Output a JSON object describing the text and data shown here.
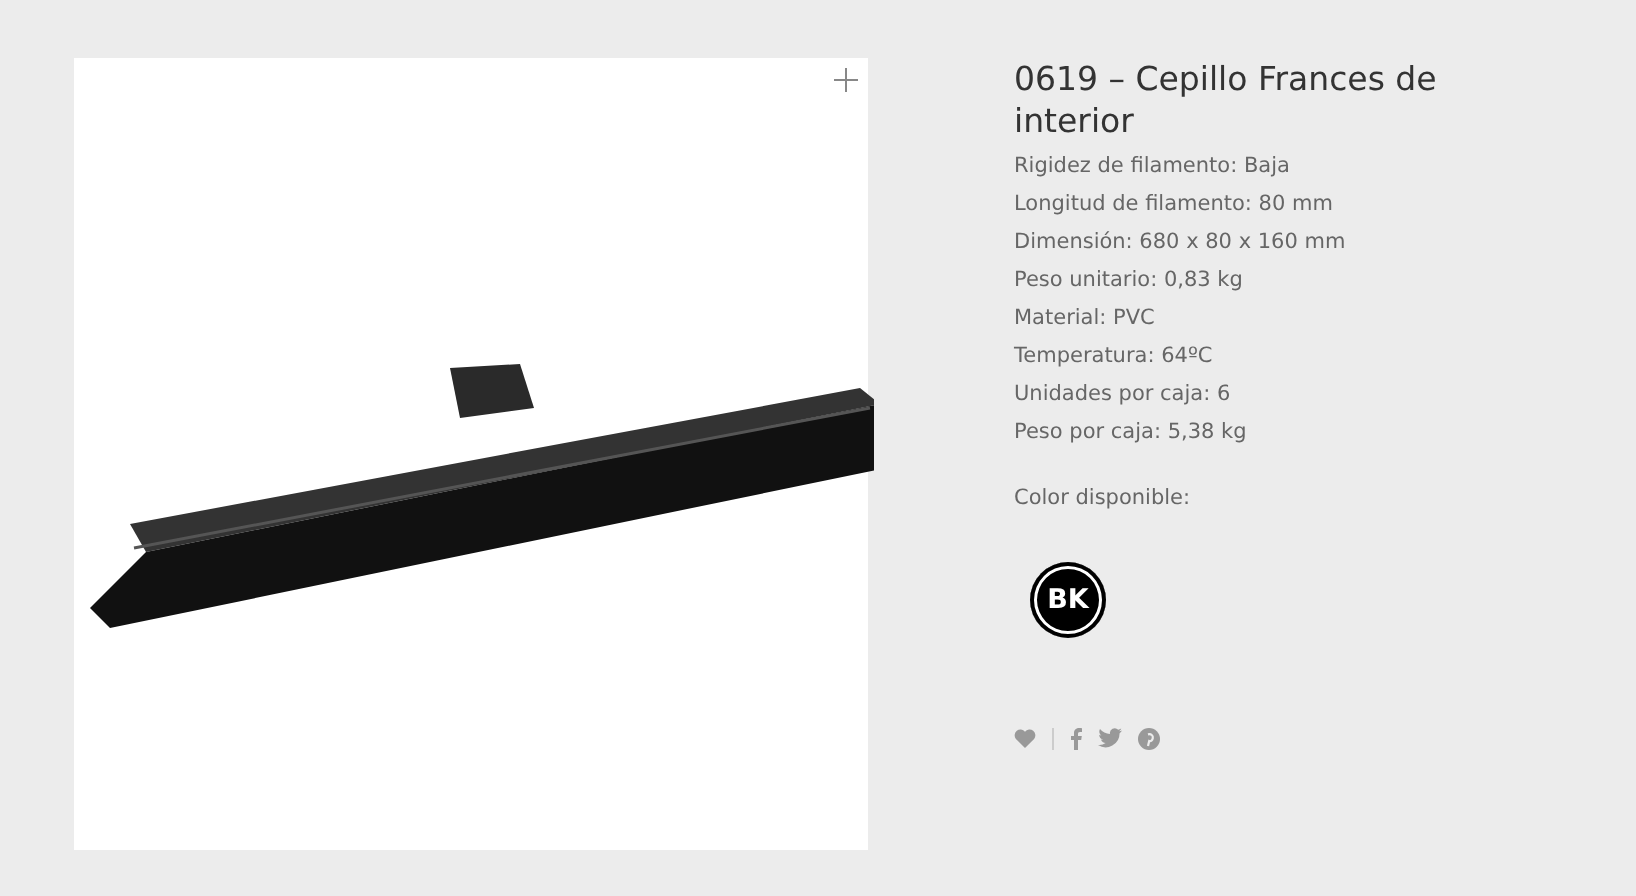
{
  "product": {
    "title": "0619 – Cepillo Frances de interior",
    "specs": [
      "Rigidez de filamento: Baja",
      "Longitud de filamento: 80 mm",
      "Dimensión: 680 x 80 x 160 mm",
      "Peso unitario: 0,83 kg",
      "Material: PVC",
      "Temperatura: 64ºC",
      "Unidades por caja: 6",
      "Peso por caja: 5,38 kg"
    ],
    "color_label": "Color disponible:",
    "colors": [
      {
        "label": "BK",
        "color": "#000000"
      }
    ]
  }
}
